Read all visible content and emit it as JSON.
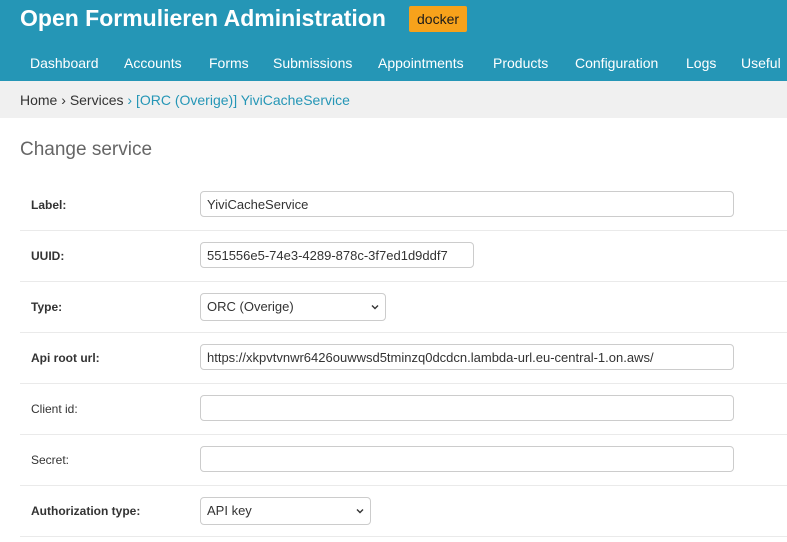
{
  "header": {
    "title": "Open Formulieren Administration",
    "env_badge": "docker",
    "color": "#2596b6",
    "badge_color": "#f7a21b"
  },
  "nav": {
    "items": [
      {
        "label": "Dashboard"
      },
      {
        "label": "Accounts"
      },
      {
        "label": "Forms"
      },
      {
        "label": "Submissions"
      },
      {
        "label": "Appointments"
      },
      {
        "label": "Products"
      },
      {
        "label": "Configuration"
      },
      {
        "label": "Logs"
      },
      {
        "label": "Useful"
      }
    ]
  },
  "breadcrumb": {
    "home": "Home",
    "services": "Services",
    "current": "[ORC (Overige)] YiviCacheService",
    "separator": "›"
  },
  "page": {
    "title": "Change service"
  },
  "form": {
    "label": {
      "label": "Label:",
      "value": "YiviCacheService"
    },
    "uuid": {
      "label": "UUID:",
      "value": "551556e5-74e3-4289-878c-3f7ed1d9ddf7"
    },
    "type": {
      "label": "Type:",
      "value": "ORC (Overige)"
    },
    "api_root": {
      "label": "Api root url:",
      "value": "https://xkpvtvnwr6426ouwwsd5tminzq0dcdcn.lambda-url.eu-central-1.on.aws/"
    },
    "client_id": {
      "label": "Client id:",
      "value": ""
    },
    "secret": {
      "label": "Secret:",
      "value": ""
    },
    "auth_type": {
      "label": "Authorization type:",
      "value": "API key"
    }
  }
}
